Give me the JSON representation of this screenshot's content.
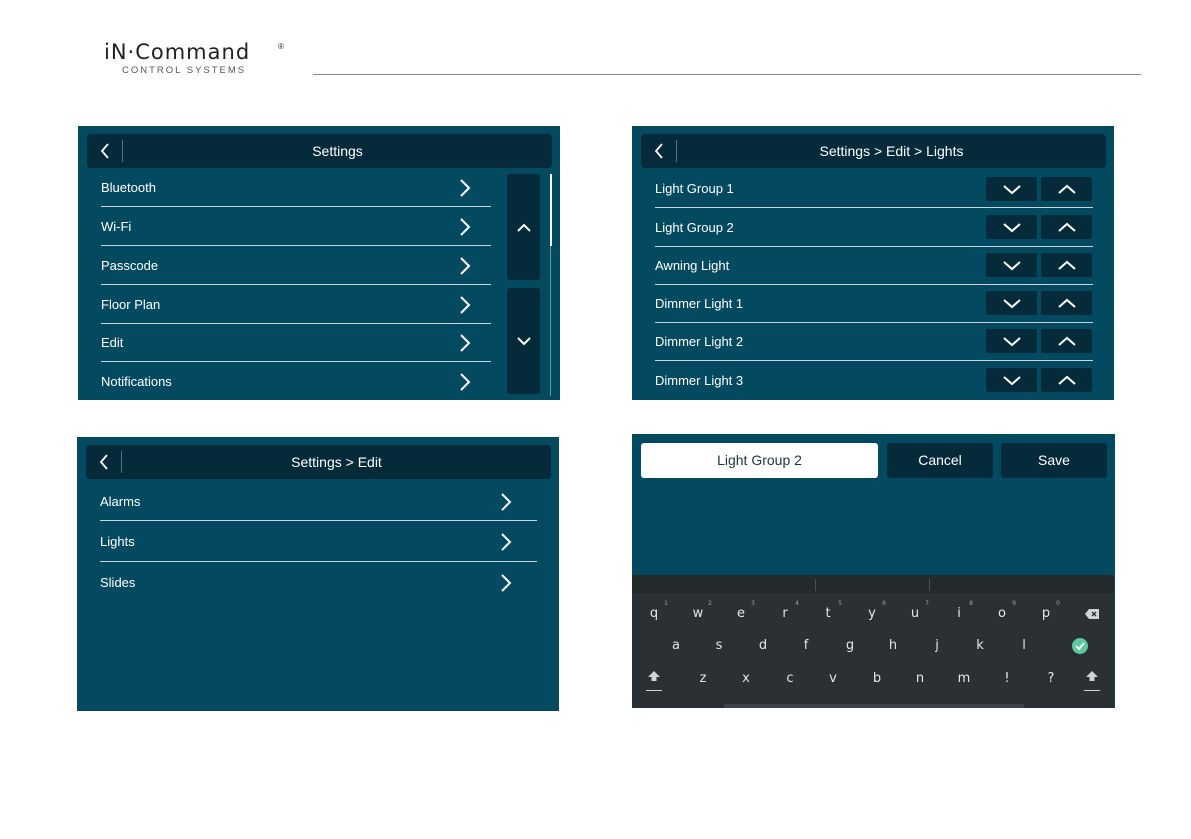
{
  "brand": {
    "name": "iN·Command",
    "registered": "®",
    "subtitle": "CONTROL SYSTEMS"
  },
  "colors": {
    "panel_bg": "#034a60",
    "titlebar_bg": "#052b3b",
    "keyboard_bg": "#2a3033",
    "confirm_green": "#5cc8a0"
  },
  "settings_screen": {
    "title": "Settings",
    "items": [
      {
        "label": "Bluetooth"
      },
      {
        "label": "Wi-Fi"
      },
      {
        "label": "Passcode"
      },
      {
        "label": "Floor Plan"
      },
      {
        "label": "Edit"
      },
      {
        "label": "Notifications"
      }
    ]
  },
  "edit_screen": {
    "title": "Settings > Edit",
    "items": [
      {
        "label": "Alarms"
      },
      {
        "label": "Lights"
      },
      {
        "label": "Slides"
      }
    ]
  },
  "lights_screen": {
    "title": "Settings > Edit > Lights",
    "items": [
      {
        "label": "Light Group 1"
      },
      {
        "label": "Light Group 2"
      },
      {
        "label": "Awning Light"
      },
      {
        "label": "Dimmer Light 1"
      },
      {
        "label": "Dimmer Light 2"
      },
      {
        "label": "Dimmer Light 3"
      }
    ]
  },
  "rename_screen": {
    "field_value": "Light Group 2",
    "cancel_label": "Cancel",
    "save_label": "Save",
    "keyboard": {
      "row1": [
        {
          "key": "q",
          "hint": "1"
        },
        {
          "key": "w",
          "hint": "2"
        },
        {
          "key": "e",
          "hint": "3"
        },
        {
          "key": "r",
          "hint": "4"
        },
        {
          "key": "t",
          "hint": "5"
        },
        {
          "key": "y",
          "hint": "6"
        },
        {
          "key": "u",
          "hint": "7"
        },
        {
          "key": "i",
          "hint": "8"
        },
        {
          "key": "o",
          "hint": "9"
        },
        {
          "key": "p",
          "hint": "0"
        }
      ],
      "row2": [
        "a",
        "s",
        "d",
        "f",
        "g",
        "h",
        "j",
        "k",
        "l"
      ],
      "row3": [
        "z",
        "x",
        "c",
        "v",
        "b",
        "n",
        "m",
        "!",
        "?"
      ],
      "icons": {
        "backspace": "backspace-icon",
        "enter": "checkmark-icon",
        "shift": "shift-icon"
      }
    }
  }
}
